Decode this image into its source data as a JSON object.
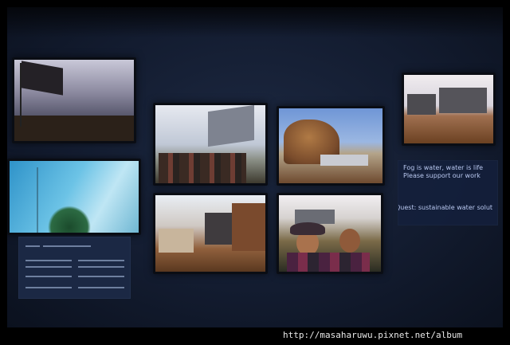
{
  "exhibit": {
    "message_lines": [
      "Fog is water, water is life",
      "Please support our work",
      "Quest: sustainable water solut"
    ],
    "photo_screens": [
      "hilltop-flag-photo",
      "misty-forest-photo",
      "group-with-fog-net-photo",
      "rock-formation-photo",
      "ridge-fog-nets-photo",
      "village-fog-nets-photo",
      "children-portrait-photo"
    ]
  },
  "watermark": {
    "url": "http://masaharuwu.pixnet.net/album"
  },
  "colors": {
    "wall": "#131c30",
    "panel_text": "#b9c8f0",
    "watermark_text": "#e8e8e8"
  }
}
